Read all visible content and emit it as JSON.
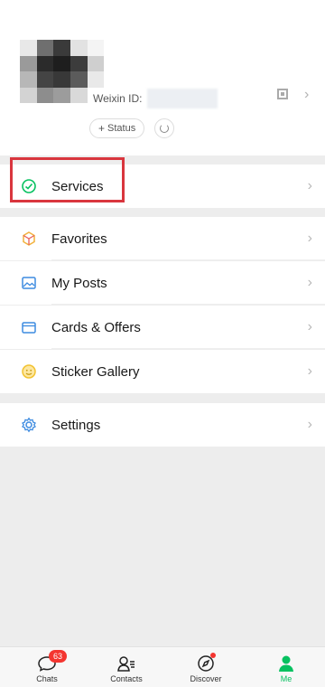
{
  "profile": {
    "weixin_id_label": "Weixin ID:",
    "status_label": "Status",
    "status_plus": "+",
    "chevron": "›"
  },
  "menu": [
    {
      "id": "services",
      "label": "Services",
      "icon": "services-icon",
      "chevron": "›"
    },
    {
      "id": "favorites",
      "label": "Favorites",
      "icon": "favorites-icon",
      "chevron": "›"
    },
    {
      "id": "my-posts",
      "label": "My Posts",
      "icon": "my-posts-icon",
      "chevron": "›"
    },
    {
      "id": "cards-offers",
      "label": "Cards & Offers",
      "icon": "cards-icon",
      "chevron": "›"
    },
    {
      "id": "sticker-gallery",
      "label": "Sticker Gallery",
      "icon": "sticker-icon",
      "chevron": "›"
    },
    {
      "id": "settings",
      "label": "Settings",
      "icon": "settings-icon",
      "chevron": "›"
    }
  ],
  "tabbar": {
    "tabs": [
      {
        "label": "Chats",
        "icon": "chats-icon",
        "badge": "63"
      },
      {
        "label": "Contacts",
        "icon": "contacts-icon"
      },
      {
        "label": "Discover",
        "icon": "discover-icon"
      },
      {
        "label": "Me",
        "icon": "me-icon",
        "active": true
      }
    ]
  },
  "colors": {
    "accent_green": "#07c160",
    "highlight_red": "#d9363e",
    "badge_red": "#f43530"
  }
}
